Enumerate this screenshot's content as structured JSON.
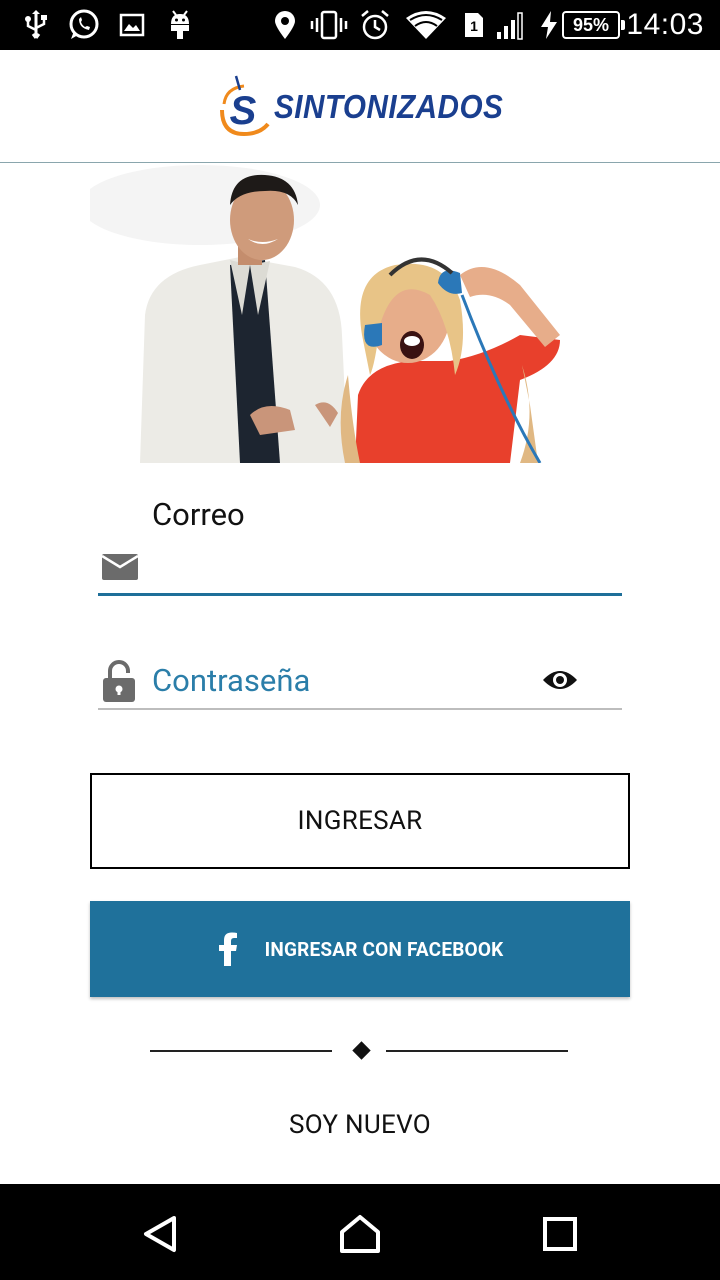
{
  "status_bar": {
    "time": "14:03",
    "battery": "95%",
    "icons": [
      "usb-icon",
      "whatsapp-icon",
      "image-icon",
      "android-debug-icon",
      "location-icon",
      "vibrate-icon",
      "alarm-icon",
      "wifi-icon",
      "sim-1-icon",
      "signal-icon",
      "charging-icon",
      "battery-icon"
    ]
  },
  "header": {
    "logo_text": "SINTONIZADOS",
    "logo_letter": "S"
  },
  "form": {
    "email_label": "Correo",
    "email_value": "",
    "password_placeholder": "Contraseña",
    "login_button": "INGRESAR",
    "facebook_button": "INGRESAR CON FACEBOOK",
    "new_user_button": "SOY NUEVO"
  },
  "colors": {
    "accent": "#1f719b",
    "logo_blue": "#1a3f8f",
    "logo_orange": "#f08a1c",
    "placeholder": "#2b7ea9"
  },
  "nav_bar": {
    "icons": [
      "back-icon",
      "home-icon",
      "recents-icon"
    ]
  }
}
